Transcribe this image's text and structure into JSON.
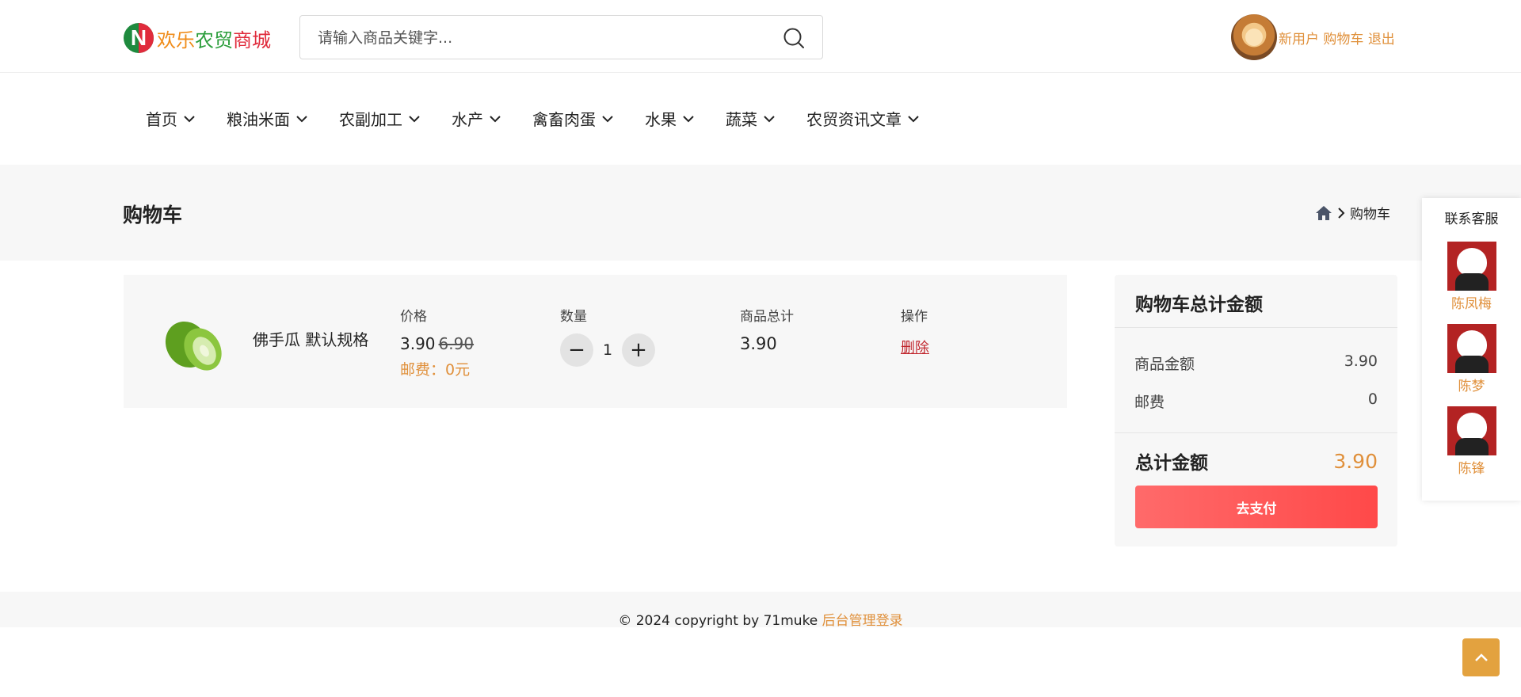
{
  "header": {
    "logo_mark": "N",
    "logo_parts": [
      "欢乐",
      "农贸",
      "商城"
    ],
    "search_placeholder": "请输入商品关键字...",
    "search_value": "",
    "user_links": [
      "新用户",
      "购物车",
      "退出"
    ]
  },
  "nav": {
    "items": [
      "首页",
      "粮油米面",
      "农副加工",
      "水产",
      "禽畜肉蛋",
      "水果",
      "蔬菜",
      "农贸资讯文章"
    ]
  },
  "page": {
    "title": "购物车",
    "breadcrumb_current": "购物车"
  },
  "cart": {
    "headers": {
      "price": "价格",
      "quantity": "数量",
      "subtotal": "商品总计",
      "action": "操作"
    },
    "items": [
      {
        "name": "佛手瓜 默认规格",
        "price": "3.90",
        "original_price": "6.90",
        "shipping": "邮费：0元",
        "quantity": "1",
        "subtotal": "3.90",
        "delete_label": "删除"
      }
    ],
    "qty_minus": "−",
    "qty_plus": "+"
  },
  "summary": {
    "title": "购物车总计金额",
    "goods_label": "商品金额",
    "goods_value": "3.90",
    "shipping_label": "邮费",
    "shipping_value": "0",
    "total_label": "总计金额",
    "total_value": "3.90",
    "pay_label": "去支付"
  },
  "service": {
    "title": "联系客服",
    "agents": [
      "陈凤梅",
      "陈梦",
      "陈锋"
    ]
  },
  "footer": {
    "copyright": "© 2024 copyright by 71muke",
    "admin_link": "后台管理登录"
  },
  "colors": {
    "accent": "#e0903b",
    "danger": "#c0262d",
    "pay_button": "#ff4949",
    "panel_bg": "#f7f7f7"
  }
}
